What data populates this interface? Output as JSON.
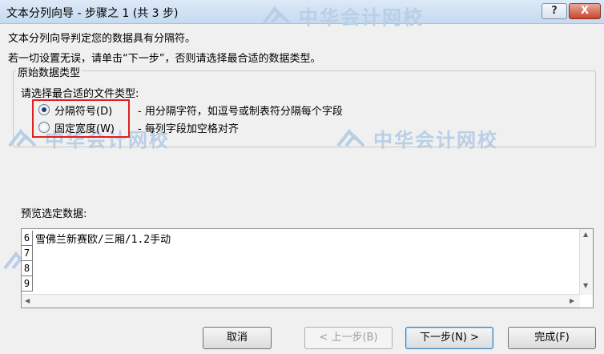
{
  "title_bar": {
    "title": "文本分列向导 - 步骤之 1 (共 3 步)",
    "help_button": "?",
    "close_button": "X"
  },
  "watermark_text": "中华会计网校",
  "intro": {
    "line1": "文本分列向导判定您的数据具有分隔符。",
    "line2": "若一切设置无误，请单击“下一步”，否则请选择最合适的数据类型。"
  },
  "original_data_type": {
    "group_title": "原始数据类型",
    "prompt": "请选择最合适的文件类型:",
    "options": [
      {
        "label": "分隔符号(D)",
        "description": "- 用分隔字符，如逗号或制表符分隔每个字段",
        "selected": true
      },
      {
        "label": "固定宽度(W)",
        "description": "- 每列字段加空格对齐",
        "selected": false
      }
    ],
    "highlight_color": "#e02020"
  },
  "preview": {
    "label": "预览选定数据:",
    "rows": [
      {
        "num": "6",
        "text": "雪佛兰新赛欧/三厢/1.2手动"
      },
      {
        "num": "7",
        "text": ""
      },
      {
        "num": "8",
        "text": ""
      },
      {
        "num": "9",
        "text": ""
      }
    ]
  },
  "buttons": {
    "cancel": "取消",
    "back": "< 上一步(B)",
    "next": "下一步(N) >",
    "finish": "完成(F)"
  }
}
